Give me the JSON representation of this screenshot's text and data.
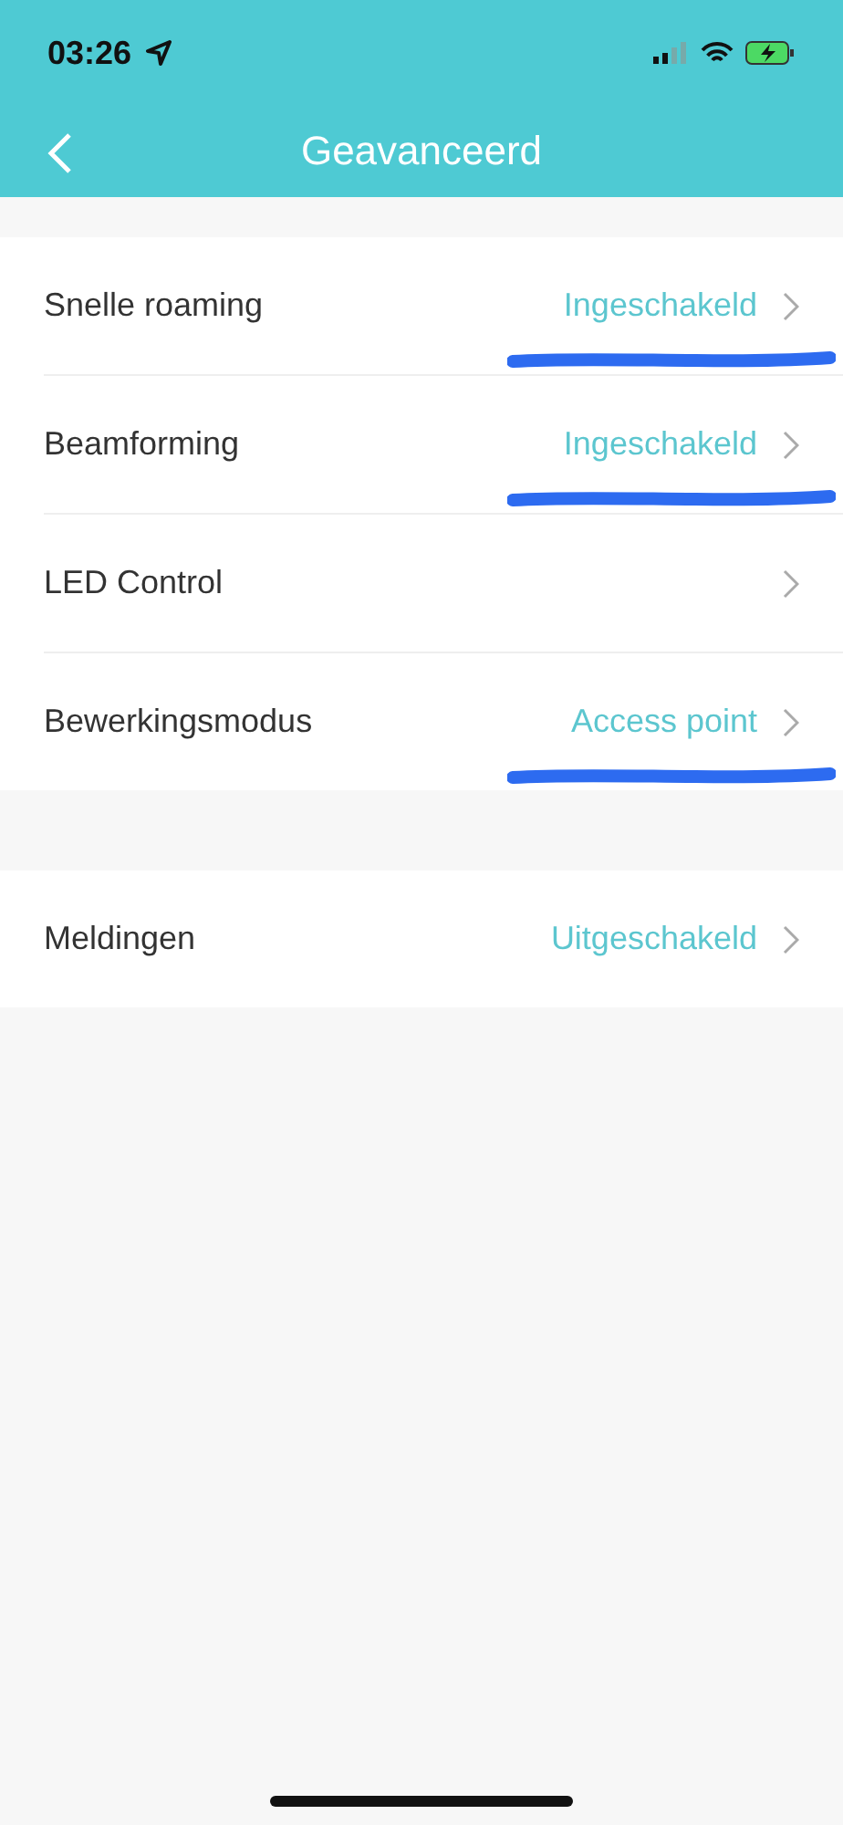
{
  "status_bar": {
    "time": "03:26"
  },
  "header": {
    "title": "Geavanceerd"
  },
  "groups": [
    {
      "rows": [
        {
          "label": "Snelle roaming",
          "value": "Ingeschakeld",
          "scribbled": true
        },
        {
          "label": "Beamforming",
          "value": "Ingeschakeld",
          "scribbled": true
        },
        {
          "label": "LED Control",
          "scribbled": false
        },
        {
          "label": "Bewerkingsmodus",
          "value": "Access point",
          "scribbled": true
        }
      ]
    },
    {
      "rows": [
        {
          "label": "Meldingen",
          "value": "Uitgeschakeld",
          "scribbled": false
        }
      ]
    }
  ]
}
